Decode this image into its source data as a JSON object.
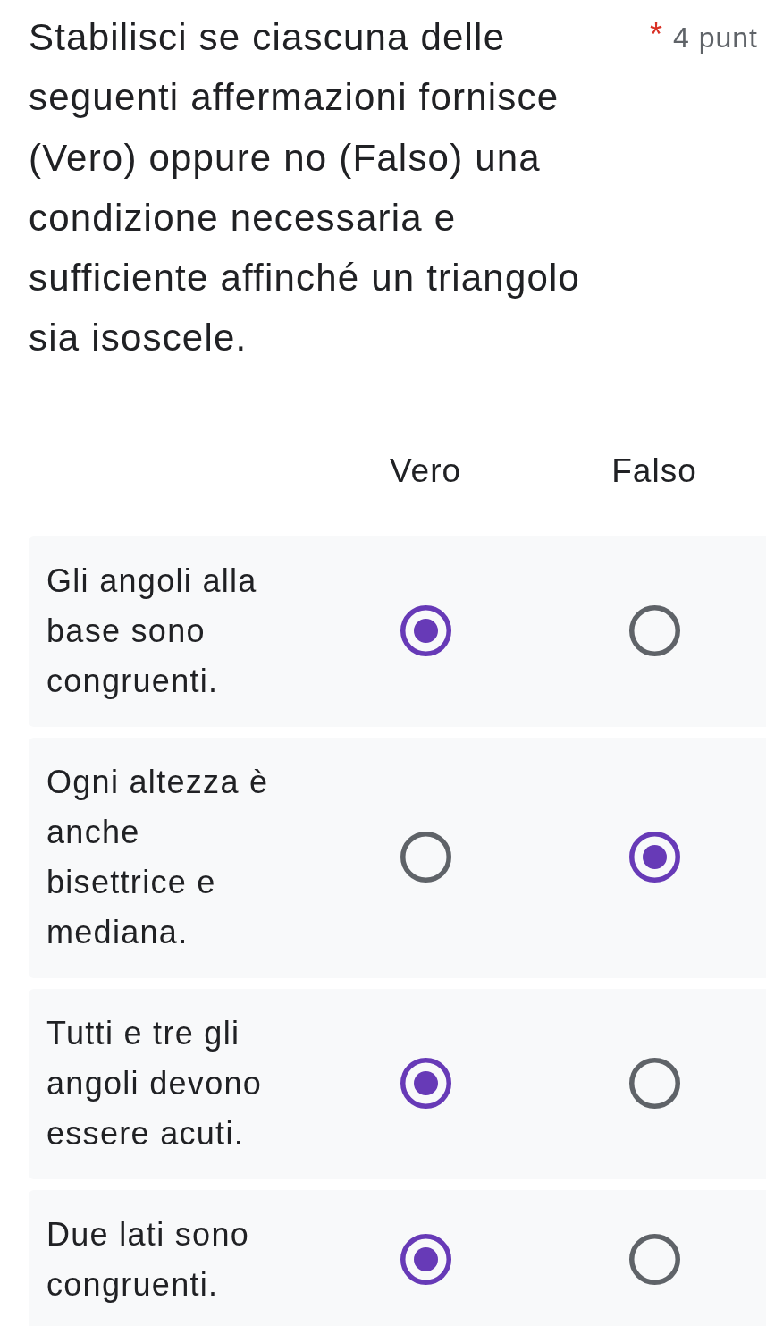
{
  "question": {
    "title": "Stabilisci se ciascuna delle seguenti affermazioni fornisce (Vero) oppure no (Falso) una condizione necessaria e sufficiente affinché un triangolo sia isoscele.",
    "required_mark": "*",
    "points": "4 punt"
  },
  "grid": {
    "columns": [
      "Vero",
      "Falso"
    ],
    "rows": [
      {
        "text": "Gli angoli alla base sono congruenti.",
        "options": [
          {
            "selected": true
          },
          {
            "selected": false
          }
        ]
      },
      {
        "text": "Ogni altezza è anche bisettrice e mediana.",
        "options": [
          {
            "selected": false
          },
          {
            "selected": true
          }
        ]
      },
      {
        "text": "Tutti e tre gli angoli devono essere acuti.",
        "options": [
          {
            "selected": true
          },
          {
            "selected": false
          }
        ]
      },
      {
        "text": "Due lati sono congruenti.",
        "options": [
          {
            "selected": true
          },
          {
            "selected": false
          }
        ]
      }
    ]
  }
}
